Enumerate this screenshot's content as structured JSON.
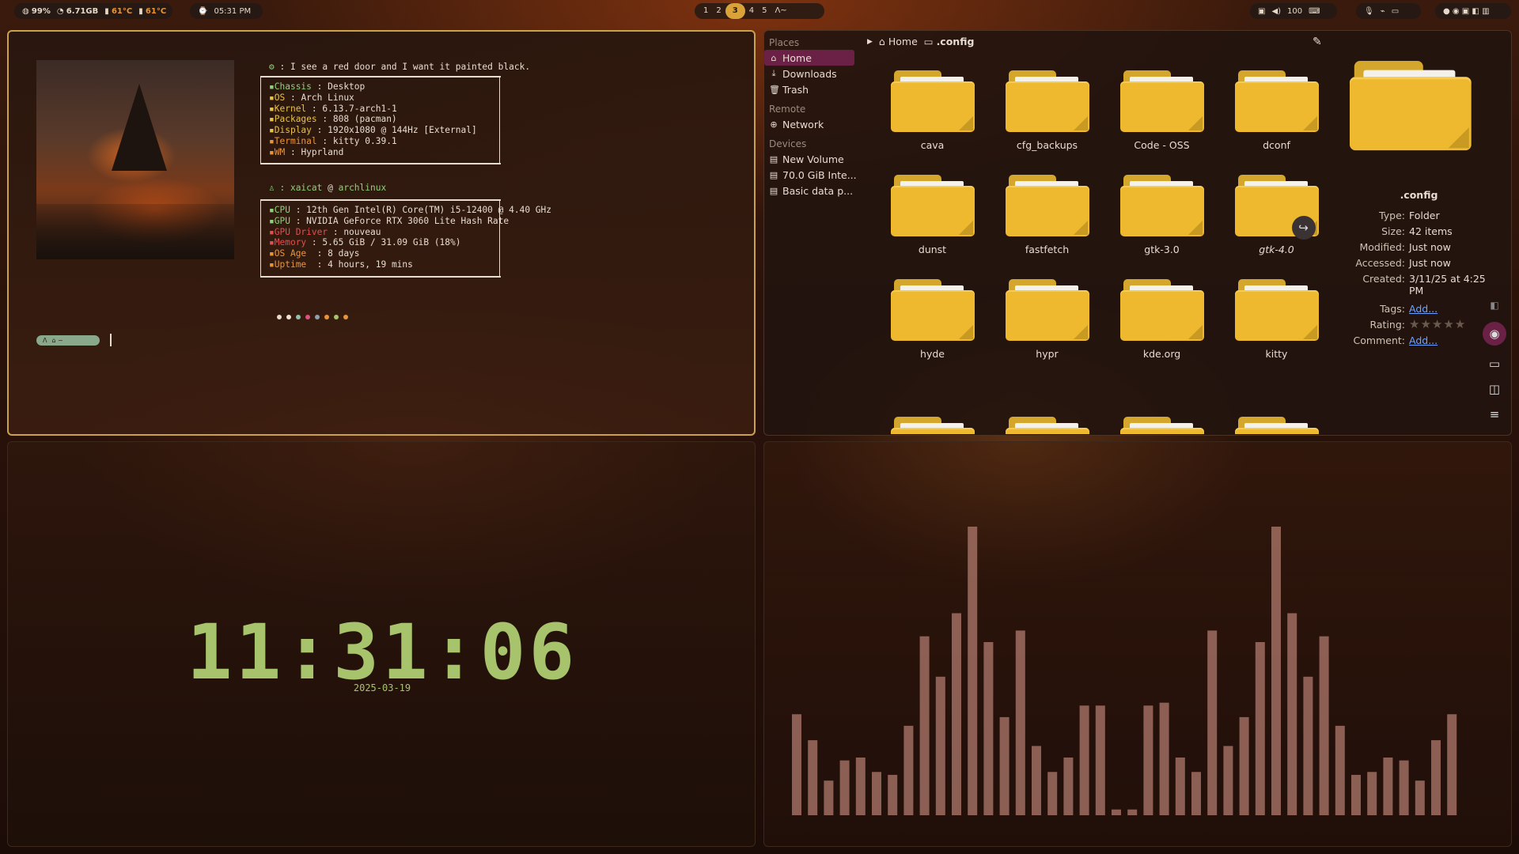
{
  "topbar": {
    "cpu": "99%",
    "mem": "6.71GB",
    "temp1": "61°C",
    "temp2": "61°C",
    "time": "05:31 PM",
    "workspaces": [
      "1",
      "2",
      "3",
      "4",
      "5"
    ],
    "active_workspace": "3",
    "volume": "100",
    "right_icons": [
      "mic-icon",
      "wifi-icon",
      "screen-icon",
      "notif-icon"
    ]
  },
  "terminal": {
    "quote": ": I see a red door and I want it painted black.",
    "sys": [
      {
        "key": "Chassis",
        "val": " : Desktop",
        "color": "#8fd17a"
      },
      {
        "key": "OS",
        "val": " : Arch Linux",
        "color": "#e8c248"
      },
      {
        "key": "Kernel",
        "val": " : 6.13.7-arch1-1",
        "color": "#e8c248"
      },
      {
        "key": "Packages",
        "val": " : 808 (pacman)",
        "color": "#e8c248"
      },
      {
        "key": "Display",
        "val": " : 1920x1080 @ 144Hz [External]",
        "color": "#e8c248"
      },
      {
        "key": "Terminal",
        "val": " : kitty 0.39.1",
        "color": "#e8953a"
      },
      {
        "key": "WM",
        "val": " : Hyprland",
        "color": "#e8953a"
      }
    ],
    "user": "xaicat",
    "host": "archlinux",
    "hw": [
      {
        "key": "CPU",
        "val": " : 12th Gen Intel(R) Core(TM) i5-12400 @ 4.40 GHz",
        "color": "#8fd17a"
      },
      {
        "key": "GPU",
        "val": " : NVIDIA GeForce RTX 3060 Lite Hash Rate",
        "color": "#8fd17a"
      },
      {
        "key": "GPU Driver",
        "val": " : nouveau",
        "color": "#e05050"
      },
      {
        "key": "Memory",
        "val": " : 5.65 GiB / 31.09 GiB (18%)",
        "color": "#e05050"
      },
      {
        "key": "OS Age",
        "val": "  : 8 days",
        "color": "#e8953a"
      },
      {
        "key": "Uptime",
        "val": "  : 4 hours, 19 mins",
        "color": "#e8953a"
      }
    ],
    "dot_colors": [
      "#e8dcd0",
      "#f0e4d4",
      "#8fc0b0",
      "#e05080",
      "#8fa0b0",
      "#e8953a",
      "#a7c36b",
      "#e8953a"
    ]
  },
  "filemanager": {
    "places_header": "Places",
    "places": [
      "Home",
      "Downloads",
      "Trash"
    ],
    "remote_header": "Remote",
    "remote": [
      "Network"
    ],
    "devices_header": "Devices",
    "devices": [
      "New Volume",
      "70.0 GiB Inte...",
      "Basic data p..."
    ],
    "crumb_home": "Home",
    "crumb_current": ".config",
    "folders": [
      "cava",
      "cfg_backups",
      "Code - OSS",
      "dconf",
      "dunst",
      "fastfetch",
      "gtk-3.0",
      "gtk-4.0",
      "hyde",
      "hypr",
      "kde.org",
      "kitty"
    ],
    "info": {
      "title": ".config",
      "type_label": "Type:",
      "type": "Folder",
      "size_label": "Size:",
      "size": "42 items",
      "modified_label": "Modified:",
      "modified": "Just now",
      "accessed_label": "Accessed:",
      "accessed": "Just now",
      "created_label": "Created:",
      "created": "3/11/25 at 4:25 PM",
      "tags_label": "Tags:",
      "tags": "Add...",
      "rating_label": "Rating:",
      "rating": "★★★★★",
      "comment_label": "Comment:",
      "comment": "Add..."
    }
  },
  "clock": {
    "time": "11:31:06",
    "date": "2025-03-19"
  },
  "visualizer": {
    "levels": [
      0.35,
      0.26,
      0.12,
      0.19,
      0.2,
      0.15,
      0.14,
      0.31,
      0.62,
      0.48,
      0.7,
      1.0,
      0.6,
      0.34,
      0.64,
      0.24,
      0.15,
      0.2,
      0.38,
      0.38,
      0.02,
      0.02,
      0.38,
      0.39,
      0.2,
      0.15,
      0.64,
      0.24,
      0.34,
      0.6,
      1.0,
      0.7,
      0.48,
      0.62,
      0.31,
      0.14,
      0.15,
      0.2,
      0.19,
      0.12,
      0.26,
      0.35
    ]
  }
}
